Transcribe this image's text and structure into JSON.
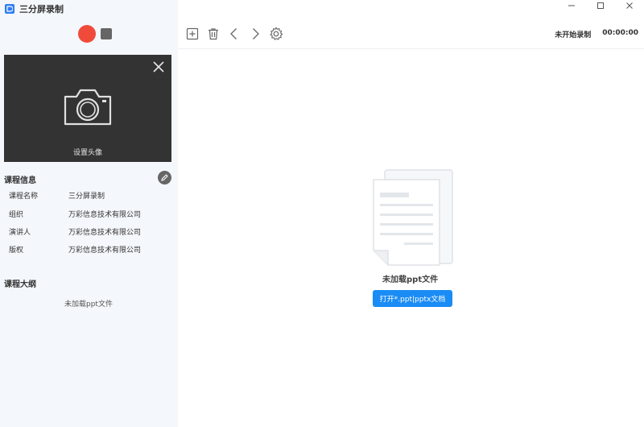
{
  "app": {
    "title": "三分屏录制",
    "icon": "app-logo-icon"
  },
  "recorder": {
    "record_icon": "record-icon",
    "stop_icon": "stop-icon",
    "record_color": "#f04b3a"
  },
  "avatar": {
    "label": "设置头像",
    "camera_icon": "camera-icon",
    "close_icon": "close-icon"
  },
  "course_info": {
    "title": "课程信息",
    "edit_icon": "pencil-icon",
    "rows": [
      {
        "key": "课程名称",
        "value": "三分屏录制"
      },
      {
        "key": "组织",
        "value": "万彩信息技术有限公司"
      },
      {
        "key": "演讲人",
        "value": "万彩信息技术有限公司"
      },
      {
        "key": "版权",
        "value": "万彩信息技术有限公司"
      }
    ]
  },
  "outline": {
    "title": "课程大纲",
    "empty_text": "未加载ppt文件"
  },
  "toolbar": {
    "icons": [
      "add-icon",
      "delete-icon",
      "prev-icon",
      "next-icon",
      "settings-icon"
    ]
  },
  "status": {
    "state": "未开始录制",
    "timer": "00:00:00"
  },
  "main": {
    "empty_title": "未加载ppt文件",
    "open_button": "打开*.ppt|pptx文档"
  },
  "colors": {
    "accent": "#1a8cf5",
    "sidebar_bg": "#f4f7fb"
  }
}
